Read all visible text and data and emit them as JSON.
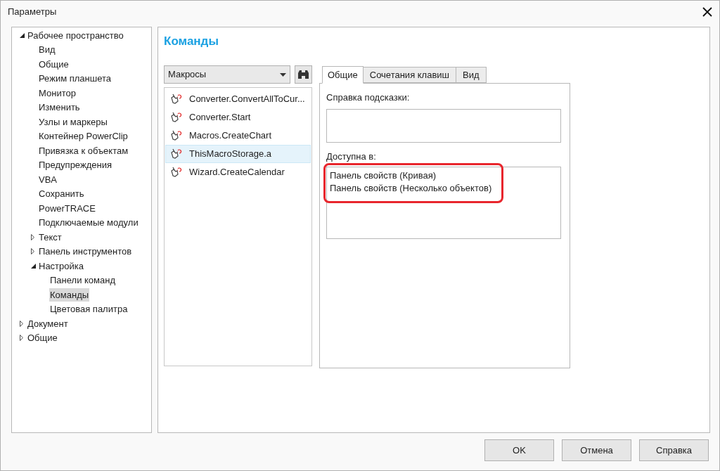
{
  "window": {
    "title": "Параметры"
  },
  "tree": [
    {
      "label": "Рабочее пространство",
      "expanded": true,
      "selected": false,
      "children": [
        {
          "label": "Вид",
          "selected": false
        },
        {
          "label": "Общие",
          "selected": false
        },
        {
          "label": "Режим планшета",
          "selected": false
        },
        {
          "label": "Монитор",
          "selected": false
        },
        {
          "label": "Изменить",
          "selected": false
        },
        {
          "label": "Узлы и маркеры",
          "selected": false
        },
        {
          "label": "Контейнер PowerClip",
          "selected": false
        },
        {
          "label": "Привязка к объектам",
          "selected": false
        },
        {
          "label": "Предупреждения",
          "selected": false
        },
        {
          "label": "VBA",
          "selected": false
        },
        {
          "label": "Сохранить",
          "selected": false
        },
        {
          "label": "PowerTRACE",
          "selected": false
        },
        {
          "label": "Подключаемые модули",
          "selected": false
        },
        {
          "label": "Текст",
          "expanded": false,
          "selected": false
        },
        {
          "label": "Панель инструментов",
          "expanded": false,
          "selected": false
        },
        {
          "label": "Настройка",
          "expanded": true,
          "selected": false,
          "children": [
            {
              "label": "Панели команд",
              "selected": false
            },
            {
              "label": "Команды",
              "selected": true
            },
            {
              "label": "Цветовая палитра",
              "selected": false
            }
          ]
        }
      ]
    },
    {
      "label": "Документ",
      "expanded": false,
      "selected": false
    },
    {
      "label": "Общие",
      "expanded": false,
      "selected": false
    }
  ],
  "page": {
    "heading": "Команды",
    "category_dropdown": {
      "value": "Макросы"
    },
    "commands": [
      {
        "label": "Converter.ConvertAllToCur...",
        "selected": false
      },
      {
        "label": "Converter.Start",
        "selected": false
      },
      {
        "label": "Macros.CreateChart",
        "selected": false
      },
      {
        "label": "ThisMacroStorage.a",
        "selected": true
      },
      {
        "label": "Wizard.CreateCalendar",
        "selected": false
      }
    ],
    "tabs": [
      {
        "label": "Общие",
        "selected": true
      },
      {
        "label": "Сочетания клавиш",
        "selected": false
      },
      {
        "label": "Вид",
        "selected": false
      }
    ],
    "tooltip_help": {
      "label": "Справка подсказки:"
    },
    "available_in": {
      "label": "Доступна в:",
      "highlighted": true,
      "items": [
        "Панель свойств (Кривая)",
        "Панель свойств (Несколько объектов)"
      ]
    }
  },
  "buttons": [
    "OK",
    "Отмена",
    "Справка"
  ]
}
